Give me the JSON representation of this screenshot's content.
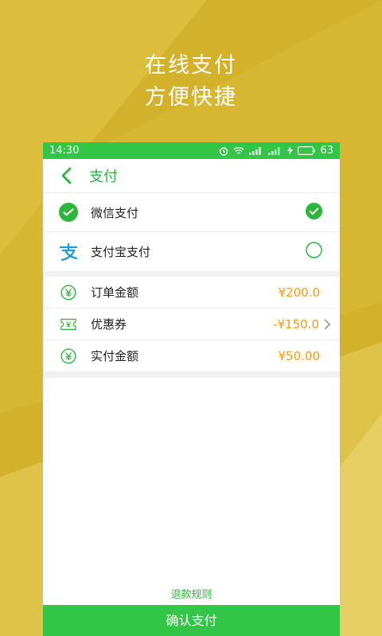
{
  "promo": {
    "line1": "在线支付",
    "line2": "方便快捷"
  },
  "status_bar": {
    "time": "14:30",
    "battery": "63"
  },
  "header": {
    "title": "支付"
  },
  "payment_methods": [
    {
      "label": "微信支付",
      "icon": "wechat-pay-icon",
      "selected": true
    },
    {
      "label": "支付宝支付",
      "icon": "alipay-icon",
      "selected": false
    }
  ],
  "amounts": {
    "order": {
      "label": "订单金额",
      "value": "¥200.0"
    },
    "coupon": {
      "label": "优惠券",
      "value": "-¥150.0"
    },
    "paid": {
      "label": "实付金额",
      "value": "¥50.00"
    }
  },
  "footer": {
    "refund_rules": "退款规则",
    "confirm": "确认支付"
  },
  "colors": {
    "green": "#33C646",
    "amount": "#F39C12",
    "background": "#D4B12B"
  }
}
